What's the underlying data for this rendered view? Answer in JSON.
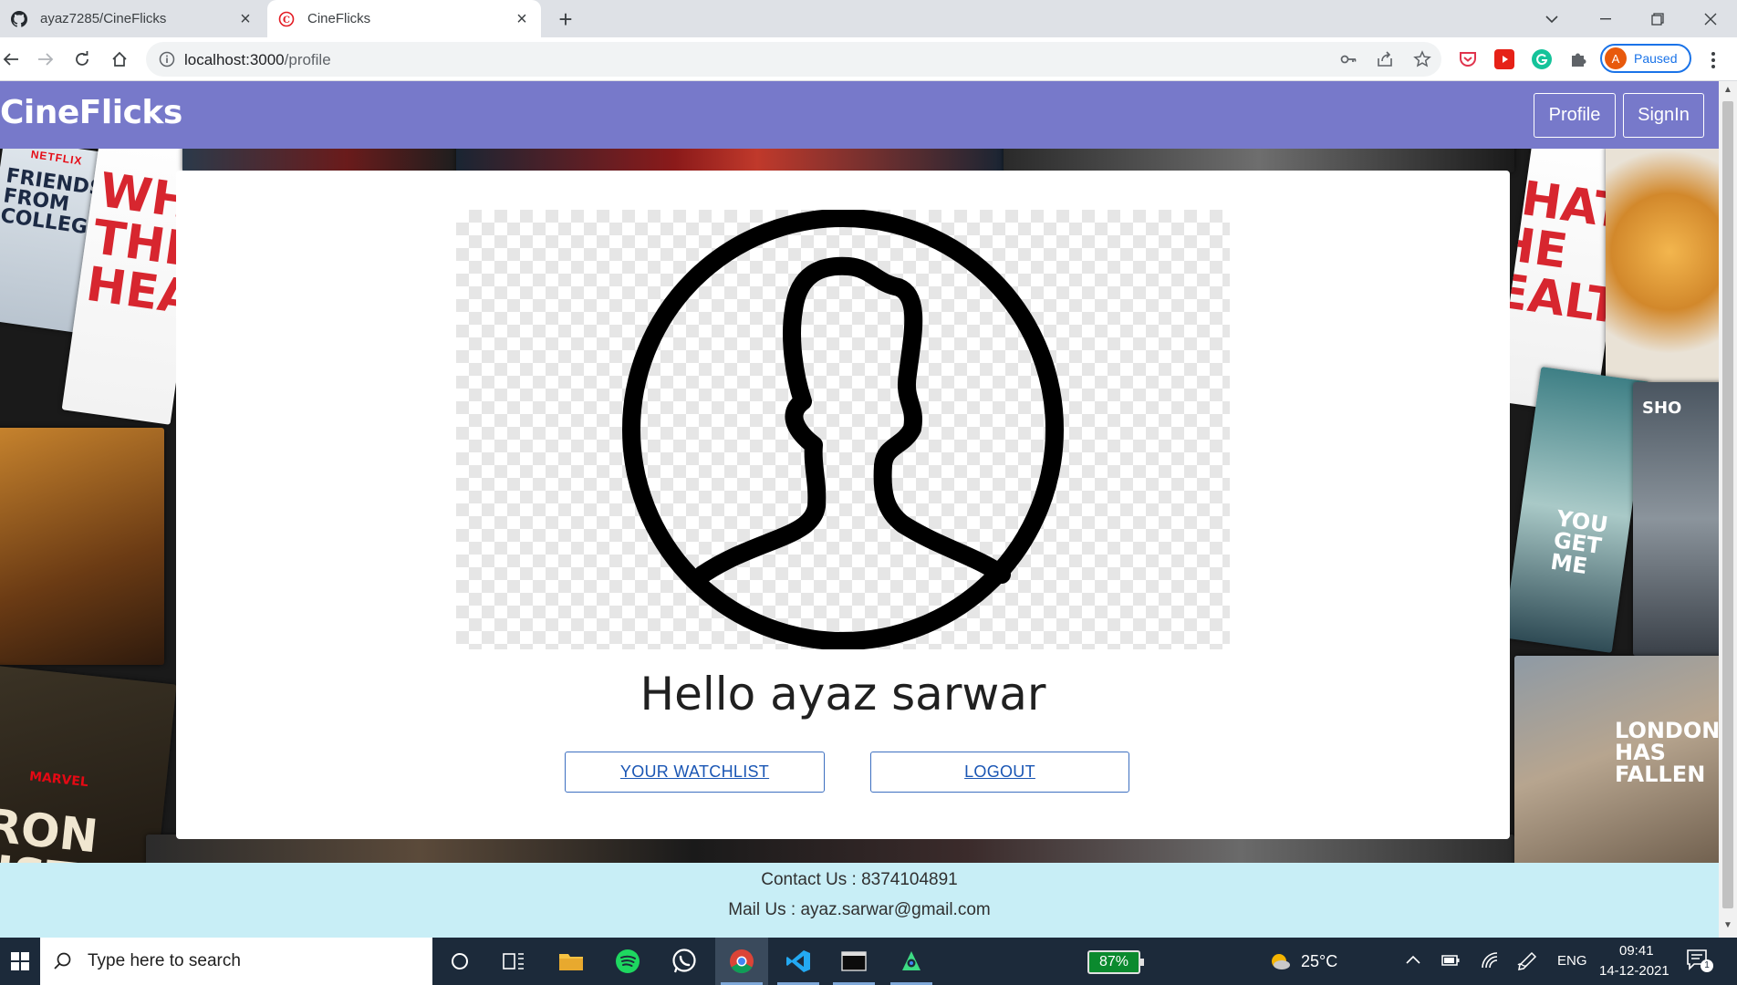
{
  "browser": {
    "tabs": [
      {
        "title": "ayaz7285/CineFlicks",
        "favicon": "github-icon",
        "active": false
      },
      {
        "title": "CineFlicks",
        "favicon": "cineflicks-icon",
        "active": true
      }
    ],
    "url_host": "localhost:3000",
    "url_path": "/profile",
    "profile_initial": "A",
    "profile_status": "Paused"
  },
  "app": {
    "brand": "CineFlicks",
    "nav": [
      {
        "label": "Profile"
      },
      {
        "label": "SignIn"
      }
    ],
    "greeting": "Hello ayaz sarwar",
    "buttons": {
      "watchlist": "YOUR WATCHLIST",
      "logout": "LOGOUT"
    },
    "footer": {
      "contact": "Contact Us : 8374104891",
      "mail": "Mail Us : ayaz.sarwar@gmail.com"
    },
    "background_posters": {
      "netflix_label": "NETFLIX",
      "friends": "FRIENDS FROM COLLEGE",
      "what_health": "WHAT THE HEALTH",
      "iron_fist": "IRON FIST",
      "marvel": "MARVEL",
      "you_get_me": "YOU GET ME",
      "london": "LONDON HAS FALLEN",
      "sho": "SHO"
    }
  },
  "taskbar": {
    "search_placeholder": "Type here to search",
    "battery": "87%",
    "weather": "25°C",
    "language": "ENG",
    "time": "09:41",
    "date": "14-12-2021",
    "notification_count": "1"
  },
  "colors": {
    "navbar": "#7779ca",
    "footer": "#c8eef6",
    "link": "#1a56b4",
    "chrome_tab_bg": "#dee1e6"
  }
}
